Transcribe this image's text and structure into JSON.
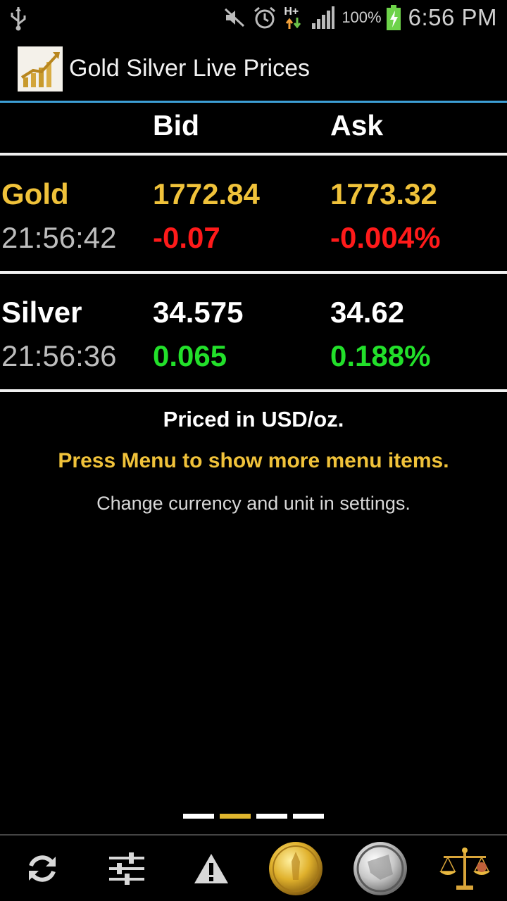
{
  "status_bar": {
    "battery_percent": "100%",
    "time": "6:56 PM",
    "network": "H+",
    "icons": [
      "usb-icon",
      "mute-icon",
      "alarm-icon",
      "network-h-plus-icon",
      "signal-icon",
      "battery-charging-icon"
    ]
  },
  "app": {
    "title": "Gold Silver Live Prices",
    "icon": "rising-chart-icon"
  },
  "table": {
    "headers": {
      "bid": "Bid",
      "ask": "Ask"
    },
    "rows": [
      {
        "name": "Gold",
        "time": "21:56:42",
        "bid": "1772.84",
        "ask": "1773.32",
        "change": "-0.07",
        "change_percent": "-0.004%"
      },
      {
        "name": "Silver",
        "time": "21:56:36",
        "bid": "34.575",
        "ask": "34.62",
        "change": "0.065",
        "change_percent": "0.188%"
      }
    ]
  },
  "info": {
    "priced_in": "Priced in USD/oz.",
    "menu_hint": "Press Menu to show more menu items.",
    "settings_hint": "Change currency and unit in settings."
  },
  "pager": {
    "pages": 4,
    "active": 2
  },
  "toolbar": {
    "buttons": [
      "refresh-icon",
      "settings-sliders-icon",
      "alert-icon",
      "gold-coin-icon",
      "silver-coin-icon",
      "scales-icon"
    ]
  },
  "colors": {
    "gold_text": "#f0c23a",
    "negative": "#ff1a1a",
    "positive": "#22e02a",
    "accent_line": "#3d9fd6"
  }
}
